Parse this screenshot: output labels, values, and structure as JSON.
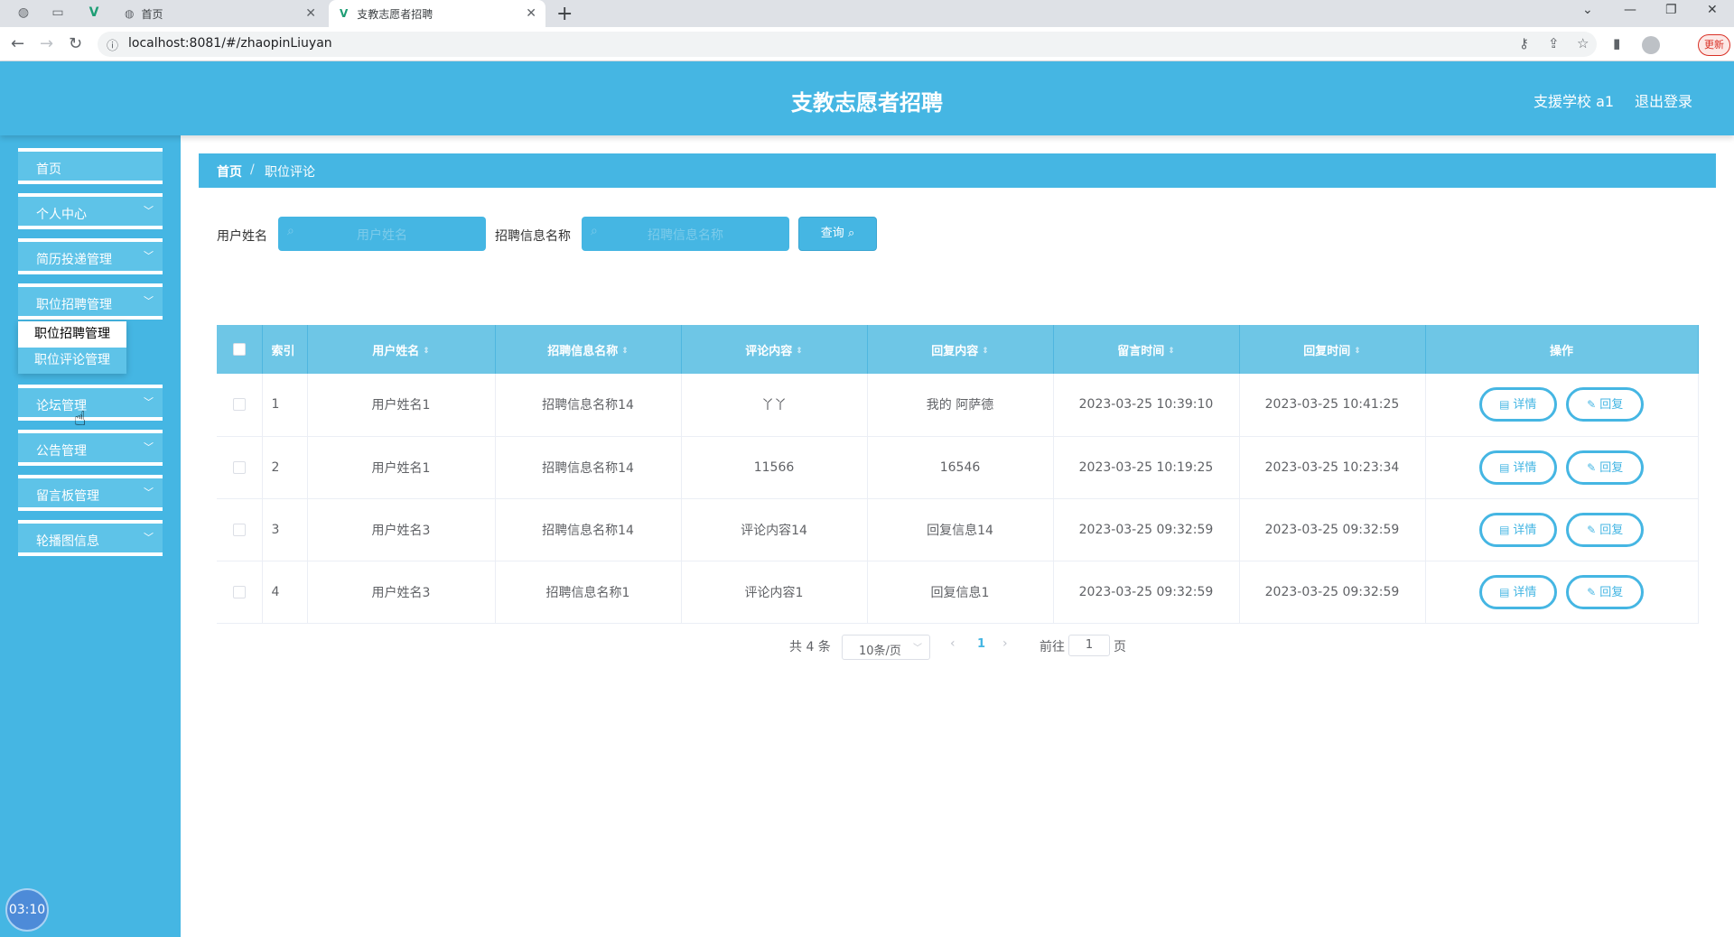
{
  "browser": {
    "tabs": [
      {
        "title": "首页"
      },
      {
        "title": "支教志愿者招聘"
      }
    ],
    "url": "localhost:8081/#/zhaopinLiuyan",
    "update_label": "更新"
  },
  "header": {
    "title": "支教志愿者招聘",
    "user": "支援学校 a1",
    "logout": "退出登录"
  },
  "sidebar": {
    "items": [
      {
        "label": "首页"
      },
      {
        "label": "个人中心"
      },
      {
        "label": "简历投递管理"
      },
      {
        "label": "职位招聘管理"
      },
      {
        "label": "论坛管理"
      },
      {
        "label": "公告管理"
      },
      {
        "label": "留言板管理"
      },
      {
        "label": "轮播图信息"
      }
    ],
    "submenu": [
      "职位招聘管理",
      "职位评论管理"
    ],
    "timer": "03:10"
  },
  "breadcrumb": {
    "home": "首页",
    "separator": "/",
    "current": "职位评论"
  },
  "search": {
    "user_label": "用户姓名",
    "user_placeholder": "用户姓名",
    "job_label": "招聘信息名称",
    "job_placeholder": "招聘信息名称",
    "button": "查询"
  },
  "table": {
    "headers": [
      "索引",
      "用户姓名",
      "招聘信息名称",
      "评论内容",
      "回复内容",
      "留言时间",
      "回复时间",
      "操作"
    ],
    "rows": [
      {
        "idx": "1",
        "user": "用户姓名1",
        "job": "招聘信息名称14",
        "comment": "丫丫",
        "reply": "我的 阿萨德",
        "time": "2023-03-25 10:39:10",
        "reply_time": "2023-03-25 10:41:25"
      },
      {
        "idx": "2",
        "user": "用户姓名1",
        "job": "招聘信息名称14",
        "comment": "11566",
        "reply": "16546",
        "time": "2023-03-25 10:19:25",
        "reply_time": "2023-03-25 10:23:34"
      },
      {
        "idx": "3",
        "user": "用户姓名3",
        "job": "招聘信息名称14",
        "comment": "评论内容14",
        "reply": "回复信息14",
        "time": "2023-03-25 09:32:59",
        "reply_time": "2023-03-25 09:32:59"
      },
      {
        "idx": "4",
        "user": "用户姓名3",
        "job": "招聘信息名称1",
        "comment": "评论内容1",
        "reply": "回复信息1",
        "time": "2023-03-25 09:32:59",
        "reply_time": "2023-03-25 09:32:59"
      }
    ],
    "detail_label": "详情",
    "reply_label": "回复"
  },
  "pagination": {
    "total": "共 4 条",
    "page_size": "10条/页",
    "current_page": "1",
    "goto_label": "前往",
    "goto_value": "1",
    "page_label": "页"
  },
  "colors": {
    "primary": "#45b6e3",
    "header_cell": "#6ec6e6",
    "menu_item": "#5ec3e8"
  }
}
